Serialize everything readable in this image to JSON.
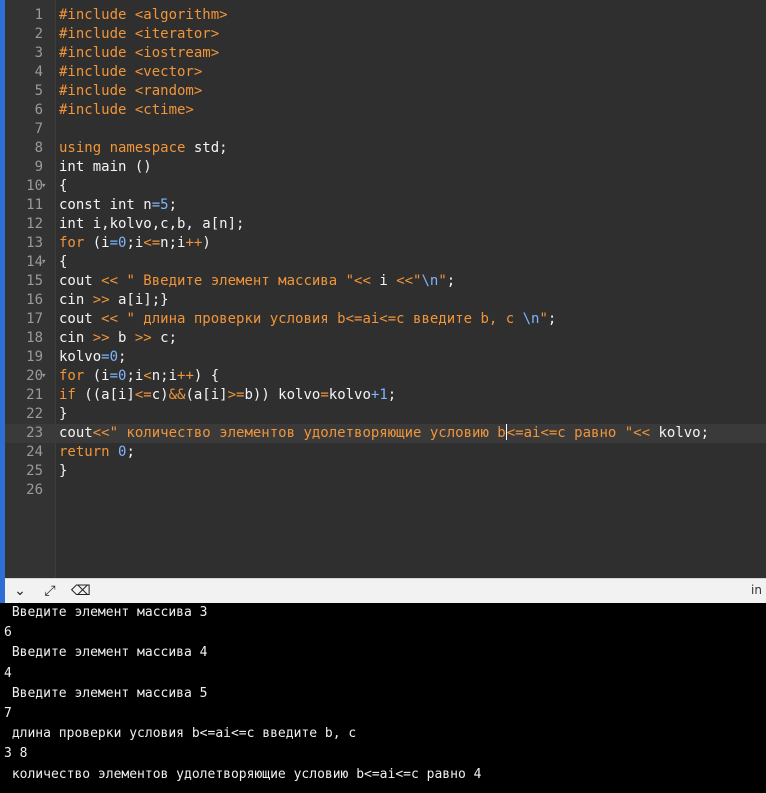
{
  "editor": {
    "active_line": 23,
    "fold_lines": [
      10,
      14,
      20
    ],
    "lines": [
      {
        "n": "1",
        "tokens": [
          {
            "t": "#include <algorithm>",
            "c": "inc"
          }
        ]
      },
      {
        "n": "2",
        "tokens": [
          {
            "t": "#include <iterator>",
            "c": "inc"
          }
        ]
      },
      {
        "n": "3",
        "tokens": [
          {
            "t": "#include <iostream>",
            "c": "inc"
          }
        ]
      },
      {
        "n": "4",
        "tokens": [
          {
            "t": "#include <vector>",
            "c": "inc"
          }
        ]
      },
      {
        "n": "5",
        "tokens": [
          {
            "t": "#include <random>",
            "c": "inc"
          }
        ]
      },
      {
        "n": "6",
        "tokens": [
          {
            "t": "#include <ctime>",
            "c": "inc"
          }
        ]
      },
      {
        "n": "7",
        "tokens": []
      },
      {
        "n": "8",
        "tokens": [
          {
            "t": "using namespace",
            "c": "kw"
          },
          {
            "t": " std;",
            "c": ""
          }
        ]
      },
      {
        "n": "9",
        "tokens": [
          {
            "t": "int main ()",
            "c": ""
          }
        ]
      },
      {
        "n": "10",
        "tokens": [
          {
            "t": "{",
            "c": ""
          }
        ]
      },
      {
        "n": "11",
        "tokens": [
          {
            "t": "const int n",
            "c": ""
          },
          {
            "t": "=5",
            "c": "num"
          },
          {
            "t": ";",
            "c": ""
          }
        ]
      },
      {
        "n": "12",
        "tokens": [
          {
            "t": "int i,kolvo,c,b, a[n];",
            "c": ""
          }
        ]
      },
      {
        "n": "13",
        "tokens": [
          {
            "t": "for",
            "c": "kw"
          },
          {
            "t": " (i",
            "c": ""
          },
          {
            "t": "=0",
            "c": "num"
          },
          {
            "t": ";i",
            "c": ""
          },
          {
            "t": "<=",
            "c": "op"
          },
          {
            "t": "n;i",
            "c": ""
          },
          {
            "t": "++",
            "c": "op"
          },
          {
            "t": ")",
            "c": ""
          }
        ]
      },
      {
        "n": "14",
        "tokens": [
          {
            "t": "{",
            "c": ""
          }
        ]
      },
      {
        "n": "15",
        "tokens": [
          {
            "t": "cout ",
            "c": ""
          },
          {
            "t": "<<",
            "c": "op"
          },
          {
            "t": " \" Введите элемент массива \"",
            "c": "str"
          },
          {
            "t": "<<",
            "c": "op"
          },
          {
            "t": " i ",
            "c": ""
          },
          {
            "t": "<<",
            "c": "op"
          },
          {
            "t": "\"",
            "c": "str"
          },
          {
            "t": "\\n",
            "c": "num"
          },
          {
            "t": "\"",
            "c": "str"
          },
          {
            "t": ";",
            "c": ""
          }
        ]
      },
      {
        "n": "16",
        "tokens": [
          {
            "t": "cin ",
            "c": ""
          },
          {
            "t": ">>",
            "c": "op"
          },
          {
            "t": " a[i];}",
            "c": ""
          }
        ]
      },
      {
        "n": "17",
        "tokens": [
          {
            "t": "cout ",
            "c": ""
          },
          {
            "t": "<<",
            "c": "op"
          },
          {
            "t": " \" длина проверки условия b<=ai<=c введите b, c ",
            "c": "str"
          },
          {
            "t": "\\n",
            "c": "num"
          },
          {
            "t": "\"",
            "c": "str"
          },
          {
            "t": ";",
            "c": ""
          }
        ]
      },
      {
        "n": "18",
        "tokens": [
          {
            "t": "cin ",
            "c": ""
          },
          {
            "t": ">>",
            "c": "op"
          },
          {
            "t": " b ",
            "c": ""
          },
          {
            "t": ">>",
            "c": "op"
          },
          {
            "t": " c;",
            "c": ""
          }
        ]
      },
      {
        "n": "19",
        "tokens": [
          {
            "t": "kolvo",
            "c": ""
          },
          {
            "t": "=0",
            "c": "num"
          },
          {
            "t": ";",
            "c": ""
          }
        ]
      },
      {
        "n": "20",
        "tokens": [
          {
            "t": "for",
            "c": "kw"
          },
          {
            "t": " (i",
            "c": ""
          },
          {
            "t": "=0",
            "c": "num"
          },
          {
            "t": ";i",
            "c": ""
          },
          {
            "t": "<",
            "c": "op"
          },
          {
            "t": "n;i",
            "c": ""
          },
          {
            "t": "++",
            "c": "op"
          },
          {
            "t": ") {",
            "c": ""
          }
        ]
      },
      {
        "n": "21",
        "tokens": [
          {
            "t": "if",
            "c": "kw"
          },
          {
            "t": " ((a[i]",
            "c": ""
          },
          {
            "t": "<=",
            "c": "op"
          },
          {
            "t": "c)",
            "c": ""
          },
          {
            "t": "&&",
            "c": "op"
          },
          {
            "t": "(a[i]",
            "c": ""
          },
          {
            "t": ">=",
            "c": "op"
          },
          {
            "t": "b)) kolvo",
            "c": ""
          },
          {
            "t": "=",
            "c": "op"
          },
          {
            "t": "kolvo",
            "c": ""
          },
          {
            "t": "+1",
            "c": "num"
          },
          {
            "t": ";",
            "c": ""
          }
        ]
      },
      {
        "n": "22",
        "tokens": [
          {
            "t": "}",
            "c": ""
          }
        ]
      },
      {
        "n": "23",
        "tokens": [
          {
            "t": "cout",
            "c": ""
          },
          {
            "t": "<<",
            "c": "op"
          },
          {
            "t": "\" количество элементов удолетворяющие условию b",
            "c": "str"
          },
          {
            "t": "|",
            "c": "cursor"
          },
          {
            "t": "<=ai<=c равно \"",
            "c": "str"
          },
          {
            "t": "<<",
            "c": "op"
          },
          {
            "t": " kolvo;",
            "c": ""
          }
        ]
      },
      {
        "n": "24",
        "tokens": [
          {
            "t": "return",
            "c": "kw"
          },
          {
            "t": " 0",
            "c": "num"
          },
          {
            "t": ";",
            "c": ""
          }
        ]
      },
      {
        "n": "25",
        "tokens": [
          {
            "t": "}",
            "c": ""
          }
        ]
      },
      {
        "n": "26",
        "tokens": []
      }
    ]
  },
  "toolbar": {
    "collapse_icon": "chevron-down-icon",
    "expand_icon": "expand-arrows-icon",
    "clear_icon": "clear-console-icon",
    "right_text": "in"
  },
  "console": {
    "lines": [
      " Введите элемент массива 3",
      "6",
      " Введите элемент массива 4",
      "4",
      " Введите элемент массива 5",
      "7",
      " длина проверки условия b<=ai<=c введите b, c",
      "3 8",
      " количество элементов удолетворяющие условию b<=ai<=c равно 4"
    ]
  }
}
